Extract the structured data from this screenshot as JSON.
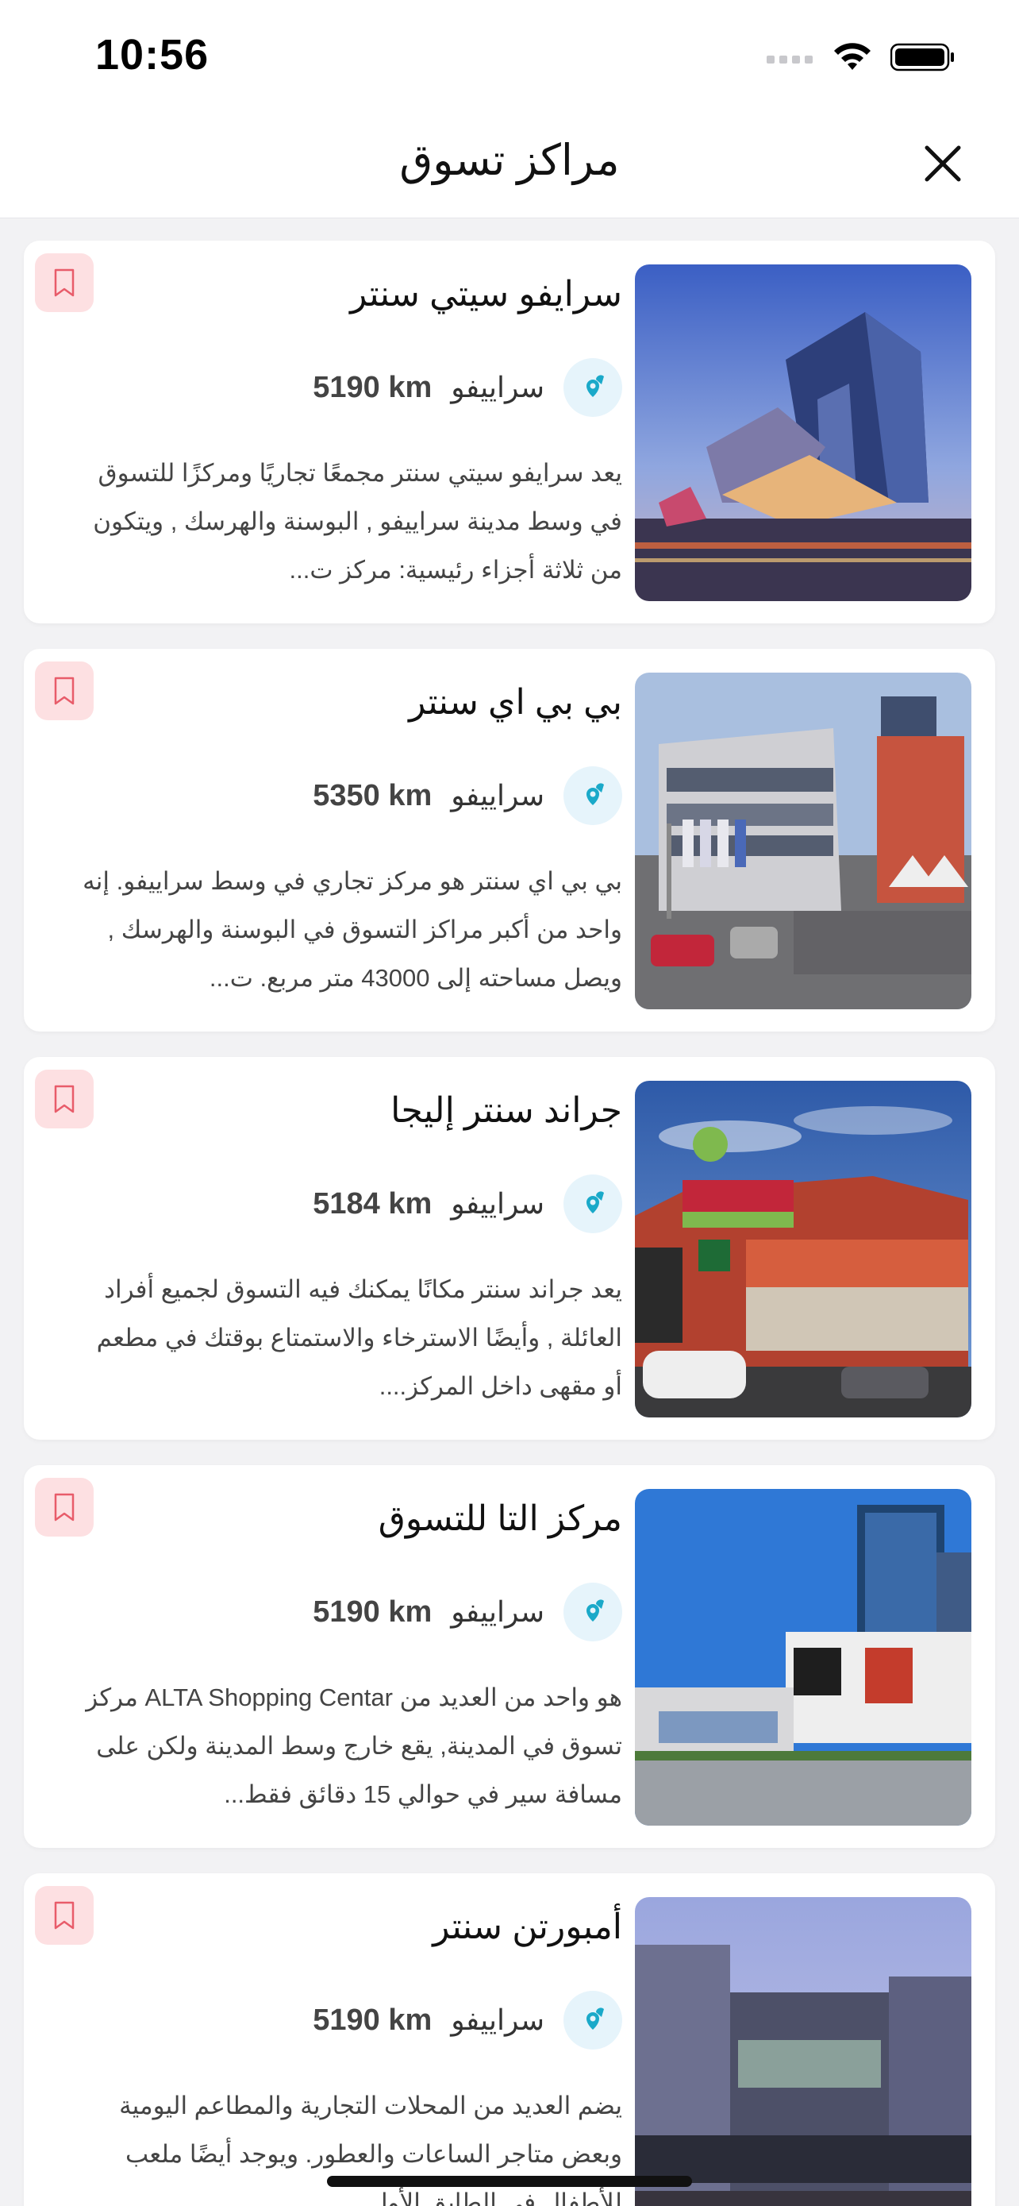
{
  "status_bar": {
    "time": "10:56"
  },
  "header": {
    "title": "مراكز تسوق"
  },
  "cards": [
    {
      "title": "سرايفو سيتي سنتر",
      "city": "سراييفو",
      "distance": "5190 km",
      "description": "يعد سرايفو سيتي سنتر مجمعًا تجاريًا ومركزًا للتسوق في وسط مدينة سراييفو , البوسنة والهرسك , ويتكون من ثلاثة أجزاء رئيسية: مركز ت..."
    },
    {
      "title": "بي بي اي سنتر",
      "city": "سراييفو",
      "distance": "5350 km",
      "description": "بي بي اي سنتر هو مركز تجاري في وسط سراييفو. إنه واحد من أكبر مراكز التسوق في البوسنة والهرسك , ويصل مساحته إلى 43000 متر مربع. ت..."
    },
    {
      "title": "جراند سنتر إليجا",
      "city": "سراييفو",
      "distance": "5184 km",
      "description": "يعد جراند سنتر مكانًا يمكنك فيه التسوق لجميع أفراد العائلة , وأيضًا الاسترخاء والاستمتاع بوقتك في مطعم أو مقهى داخل المركز...."
    },
    {
      "title": "مركز التا للتسوق",
      "city": "سراييفو",
      "distance": "5190 km",
      "description": "هو واحد من العديد من ALTA Shopping Centar مركز تسوق في المدينة, يقع خارج وسط المدينة ولكن على مسافة سير في حوالي 15 دقائق فقط..."
    },
    {
      "title": "أمبورتن سنتر",
      "city": "سراييفو",
      "distance": "5190 km",
      "description": "يضم العديد من المحلات التجارية والمطاعم اليومية وبعض متاجر الساعات والعطور. ويوجد أيضًا ملعب للأطفال في الطابق الأول"
    }
  ],
  "colors": {
    "bookmark_bg": "#fde0e2",
    "bookmark_icon": "#e85c6a",
    "pin_bg": "#e6f4fb",
    "pin_icon": "#1aa9c9"
  },
  "icons": {
    "close": "close-icon",
    "bookmark": "bookmark-icon",
    "location": "map-pin-icon"
  }
}
